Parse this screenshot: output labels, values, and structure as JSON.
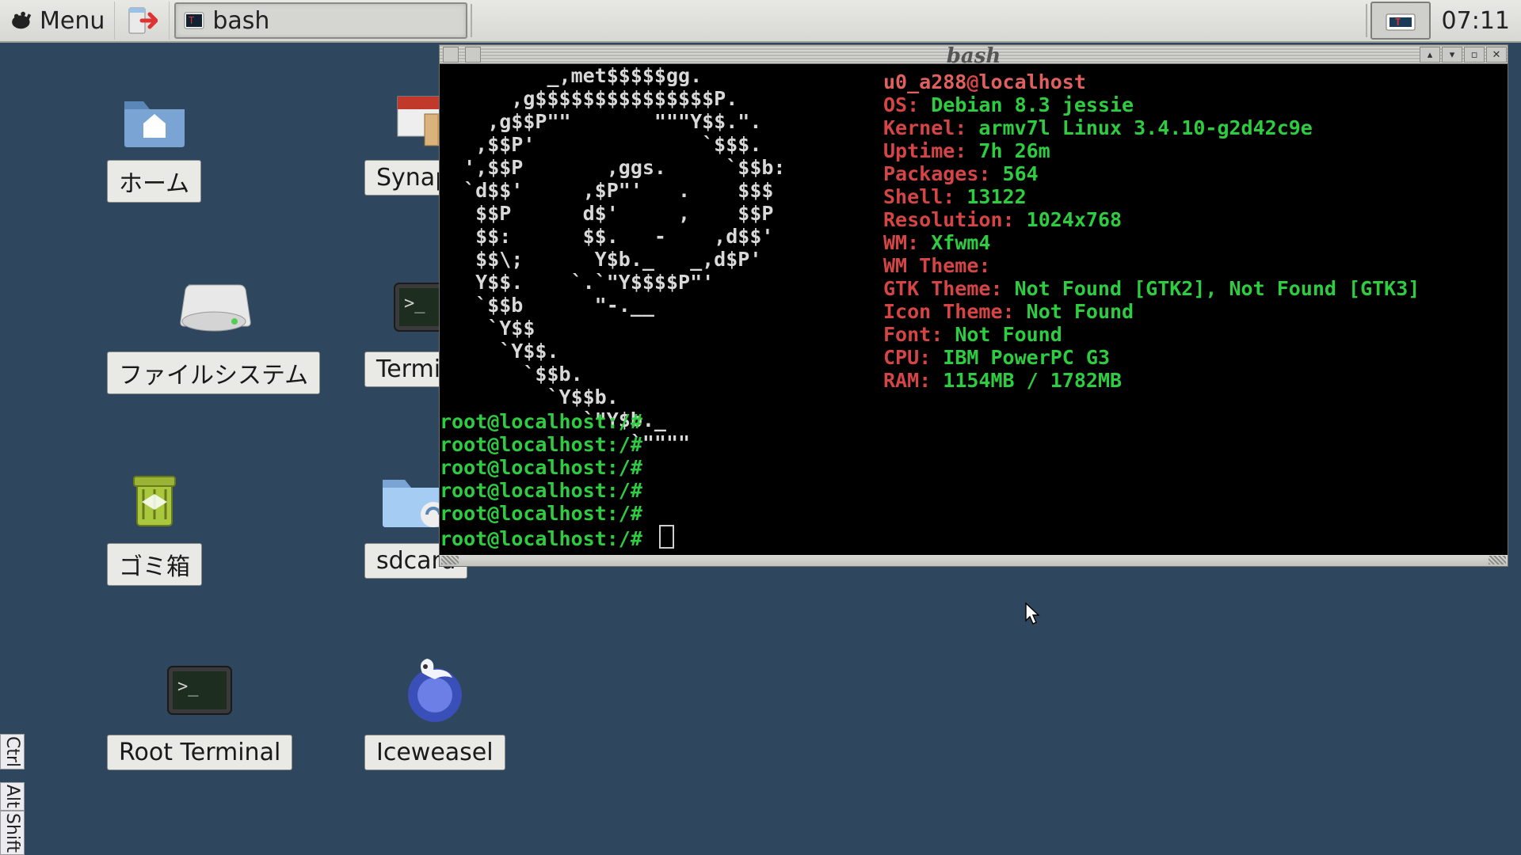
{
  "panel": {
    "menu_label": "Menu",
    "task_label": "bash",
    "clock": "07:11"
  },
  "desktop_icons": [
    {
      "id": "home",
      "label": "ホーム"
    },
    {
      "id": "filesystem",
      "label": "ファイルシステム"
    },
    {
      "id": "trash",
      "label": "ゴミ箱"
    },
    {
      "id": "root-terminal",
      "label": "Root Terminal"
    },
    {
      "id": "synaptic",
      "label": "Synaptic"
    },
    {
      "id": "terminal",
      "label": "Terminal"
    },
    {
      "id": "sdcard",
      "label": "sdcard"
    },
    {
      "id": "iceweasel",
      "label": "Iceweasel"
    }
  ],
  "side_keys": [
    "Ctrl",
    "Alt",
    "Shift"
  ],
  "terminal": {
    "title": "bash",
    "ascii": "         _,met$$$$$gg.\n      ,g$$$$$$$$$$$$$$$P.\n    ,g$$P\"\"       \"\"\"Y$$.\".\n   ,$$P'              `$$$.\n  ',$$P       ,ggs.     `$$b:\n  `d$$'     ,$P\"'   .    $$$\n   $$P      d$'     ,    $$P\n   $$:      $$.   -    ,d$$'\n   $$\\;      Y$b._   _,d$P'\n   Y$$.    `.`\"Y$$$$P\"'\n   `$$b      \"-.__\n    `Y$$\n     `Y$$.\n       `$$b.\n         `Y$$b.\n            `\"Y$b._\n                `\"\"\"\"",
    "user": "u0_a288",
    "host": "localhost",
    "info": {
      "OS": "Debian 8.3 jessie",
      "Kernel": "armv7l Linux 3.4.10-g2d42c9e",
      "Uptime": "7h 26m",
      "Packages": "564",
      "Shell": "13122",
      "Resolution": "1024x768",
      "WM": "Xfwm4",
      "WM Theme": "",
      "GTK Theme": "Not Found [GTK2], Not Found [GTK3]",
      "Icon Theme": "Not Found",
      "Font": "Not Found",
      "CPU": "IBM PowerPC G3",
      "RAM": "1154MB / 1782MB"
    },
    "prompt": "root@localhost:/#",
    "prompt_count": 6
  }
}
